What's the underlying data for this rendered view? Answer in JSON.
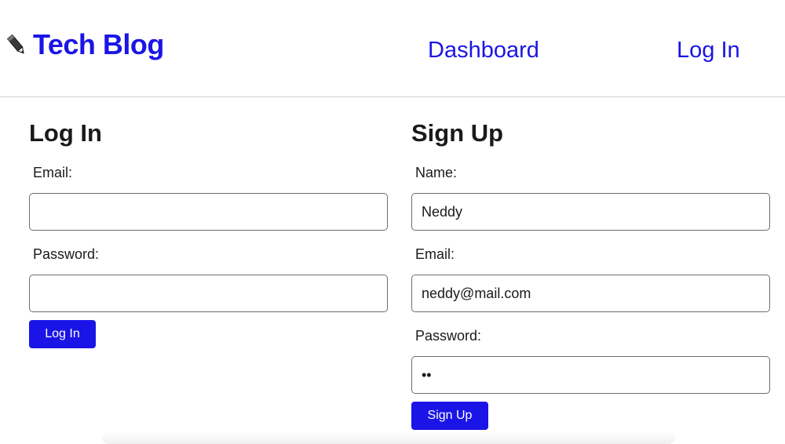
{
  "header": {
    "brand_icon": "pencil-icon",
    "brand_title": "Tech Blog",
    "nav": {
      "dashboard": "Dashboard",
      "login": "Log In"
    },
    "link_color": "#1a15e6"
  },
  "login_form": {
    "title": "Log In",
    "email_label": "Email:",
    "email_value": "",
    "password_label": "Password:",
    "password_value": "",
    "submit_label": "Log In"
  },
  "signup_form": {
    "title": "Sign Up",
    "name_label": "Name:",
    "name_value": "Neddy",
    "email_label": "Email:",
    "email_value": "neddy@mail.com",
    "password_label": "Password:",
    "password_value": "ab",
    "submit_label": "Sign Up"
  }
}
